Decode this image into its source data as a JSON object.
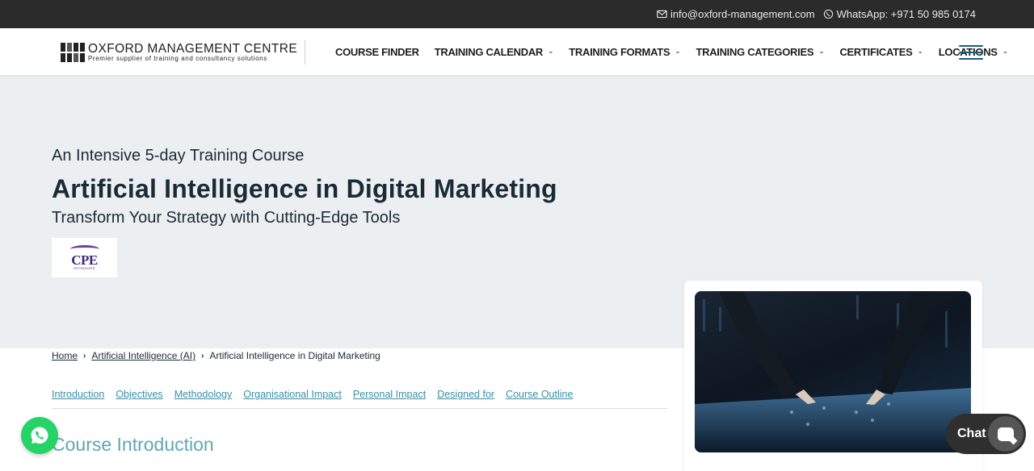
{
  "topbar": {
    "email": "info@oxford-management.com",
    "whatsapp": "WhatsApp: +971 50 985 0174"
  },
  "logo": {
    "name": "OXFORD MANAGEMENT CENTRE",
    "tagline": "Premier supplier of training and consultancy solutions"
  },
  "nav": {
    "items": [
      {
        "label": "COURSE FINDER",
        "dropdown": false
      },
      {
        "label": "TRAINING CALENDAR",
        "dropdown": true
      },
      {
        "label": "TRAINING FORMATS",
        "dropdown": true
      },
      {
        "label": "TRAINING CATEGORIES",
        "dropdown": true
      },
      {
        "label": "CERTIFICATES",
        "dropdown": true
      },
      {
        "label": "LOCATIONS",
        "dropdown": true
      }
    ]
  },
  "hero": {
    "pretitle": "An Intensive 5-day Training Course",
    "title": "Artificial Intelligence in Digital Marketing",
    "subtitle": "Transform Your Strategy with Cutting-Edge Tools",
    "badge": {
      "text": "CPE",
      "small": "SPONSORS"
    }
  },
  "breadcrumb": {
    "items": [
      "Home",
      "Artificial Intelligence (AI)",
      "Artificial Intelligence in Digital Marketing"
    ]
  },
  "anchors": {
    "items": [
      "Introduction",
      "Objectives",
      "Methodology",
      "Organisational Impact",
      "Personal Impact",
      "Designed for",
      "Course Outline"
    ]
  },
  "section": {
    "title": "Course Introduction"
  },
  "chat": {
    "label": "Chat"
  },
  "colors": {
    "topbar": "#2b2b2b",
    "hero_bg": "#eceff1",
    "link": "#3a8fa3",
    "section_title": "#5ca8b7",
    "whatsapp": "#25d366"
  }
}
